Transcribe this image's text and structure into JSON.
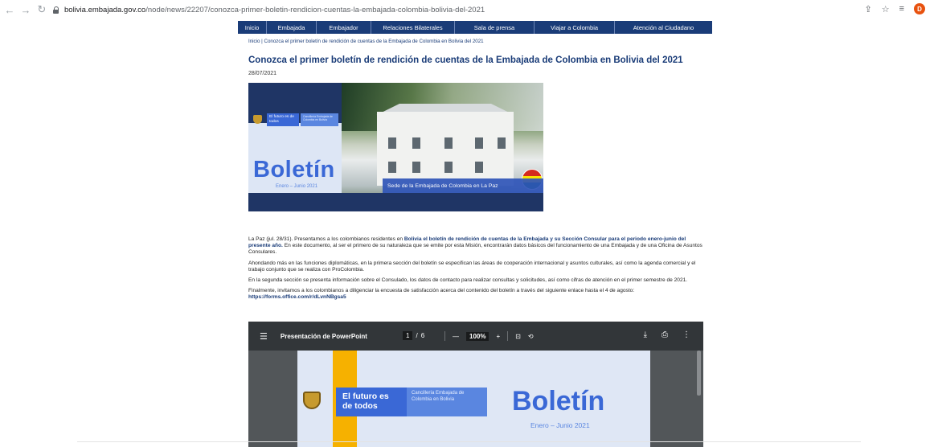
{
  "browser": {
    "url_domain": "bolivia.embajada.gov.co",
    "url_path": "/node/news/22207/conozca-primer-boletin-rendicion-cuentas-la-embajada-colombia-bolivia-del-2021",
    "avatar_initial": "D"
  },
  "nav": {
    "items": [
      {
        "label": "Inicio",
        "width": 1
      },
      {
        "label": "Embajada"
      },
      {
        "label": "Embajador"
      },
      {
        "label": "Relaciones Bilaterales"
      },
      {
        "label": "Sala de prensa"
      },
      {
        "label": "Viajar a Colombia"
      },
      {
        "label": "Atención al Ciudadano"
      }
    ]
  },
  "breadcrumb": "Inicio | Conozca el primer boletín de rendición de cuentas de la Embajada de Colombia en Bolivia del 2021",
  "article": {
    "title": "Conozca el primer boletín de rendición de cuentas de la Embajada de Colombia en Bolivia del 2021",
    "date": "28/07/2021",
    "p1_a": "La Paz (jul. 28/31). Presentamos a los colombianos residentes en ",
    "p1_bold": "Bolivia el boletín de rendición de cuentas de la Embajada y su Sección Consular para el periodo enero-junio del presente año.",
    "p1_b": " En este documento, al ser el primero de su naturaleza que se emite por esta Misión, encontrarán datos básicos del funcionamiento de una Embajada y de una Oficina de Asuntos Consulares.",
    "p2": "Ahondando más en las funciones diplomáticas, en la primera sección del boletín se especifican las áreas de cooperación internacional y asuntos culturales, así como la agenda comercial y el trabajo conjunto que se realiza con ProColombia.",
    "p3": "En la segunda sección se presenta información sobre el Consulado, los datos de contacto para realizar consultas y solicitudes, así como cifras de atención en el primer semestre de 2021.",
    "p4": "Finalmente, invitamos a los colombianos a diligenciar la encuesta de satisfacción acerca del contenido del boletín a través del siguiente enlace hasta el 4 de agosto:",
    "link": "https://forms.office.com/r/dLvnNBgsa5"
  },
  "hero": {
    "futuro": "El futuro es de todos",
    "cancilleria": "Cancillería Embajada de Colombia en Bolivia",
    "boletin": "Boletín",
    "period": "Enero – Junio 2021",
    "caption": "Sede de la Embajada de Colombia en La Paz"
  },
  "pdf": {
    "title": "Presentación de PowerPoint",
    "page_current": "1",
    "page_total": "6",
    "zoom": "100%",
    "futuro": "El futuro es de todos",
    "cancilleria": "Cancillería Embajada de Colombia en Bolivia",
    "boletin": "Boletín",
    "period": "Enero – Junio 2021"
  },
  "colors": {
    "brand_navy": "#1a3c78",
    "brand_blue": "#3a68d6",
    "brand_yellow": "#f6b100",
    "pdf_toolbar": "#323639"
  }
}
